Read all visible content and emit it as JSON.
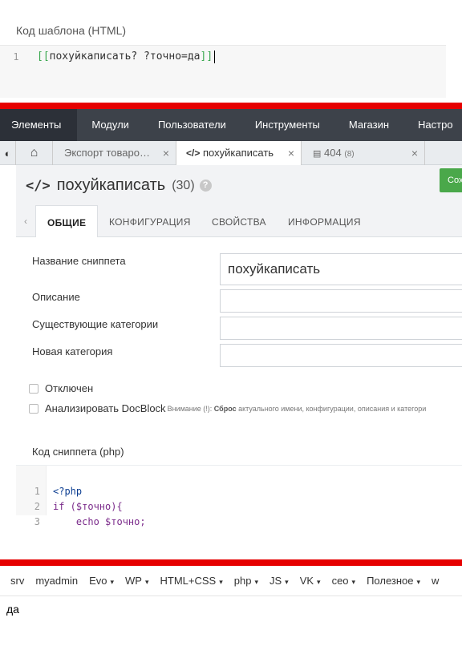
{
  "template_panel": {
    "label": "Код шаблона (HTML)",
    "line_number": "1",
    "open_brackets": "[[",
    "code_text": "похуйкаписать? ?точно=да",
    "close_brackets": "]]"
  },
  "colors": {
    "accent_red": "#e60000",
    "nav_bg": "#3d424a",
    "save_green": "#4aa84a"
  },
  "top_nav": {
    "items": [
      {
        "label": "Элементы"
      },
      {
        "label": "Модули"
      },
      {
        "label": "Пользователи"
      },
      {
        "label": "Инструменты"
      },
      {
        "label": "Магазин"
      },
      {
        "label": "Настро"
      }
    ]
  },
  "tabs": [
    {
      "label": "Экспорт товаро…",
      "close": "×"
    },
    {
      "label": "похуйкаписать",
      "close": "×",
      "icon": "code-icon"
    },
    {
      "label": "404",
      "badge": "(8)",
      "close": "×",
      "icon": "page-icon"
    }
  ],
  "snippet": {
    "title": "похуйкаписать",
    "count": "(30)",
    "help": "?",
    "save_label": "Сох"
  },
  "subtabs": [
    {
      "label": "ОБЩИЕ"
    },
    {
      "label": "КОНФИГУРАЦИЯ"
    },
    {
      "label": "СВОЙСТВА"
    },
    {
      "label": "ИНФОРМАЦИЯ"
    }
  ],
  "form": {
    "name_label": "Название сниппета",
    "name_value": "похуйкаписать",
    "description_label": "Описание",
    "description_value": "",
    "existing_categories_label": "Существующие категории",
    "existing_categories_value": "",
    "new_category_label": "Новая категория",
    "new_category_value": "",
    "disabled_label": "Отключен",
    "docblock_label": "Анализировать DocBlock",
    "hint_prefix": "Внимание (!): ",
    "hint_bold": "Сброс",
    "hint_rest": " актуального имени, конфигурации, описания и категори",
    "code_label": "Код сниппета (php)"
  },
  "php_code": [
    {
      "n": "1",
      "text": "<?php"
    },
    {
      "n": "2",
      "text": "if ($точно){"
    },
    {
      "n": "3",
      "text": "    echo $точно;"
    }
  ],
  "bookmarks": [
    {
      "label": "srv",
      "dropdown": false
    },
    {
      "label": "myadmin",
      "dropdown": false
    },
    {
      "label": "Evo",
      "dropdown": true
    },
    {
      "label": "WP",
      "dropdown": true
    },
    {
      "label": "HTML+CSS",
      "dropdown": true
    },
    {
      "label": "php",
      "dropdown": true
    },
    {
      "label": "JS",
      "dropdown": true
    },
    {
      "label": "VK",
      "dropdown": true
    },
    {
      "label": "ceo",
      "dropdown": true
    },
    {
      "label": "Полезное",
      "dropdown": true
    },
    {
      "label": "w",
      "dropdown": false
    }
  ],
  "caret": "▾",
  "output_text": "да"
}
